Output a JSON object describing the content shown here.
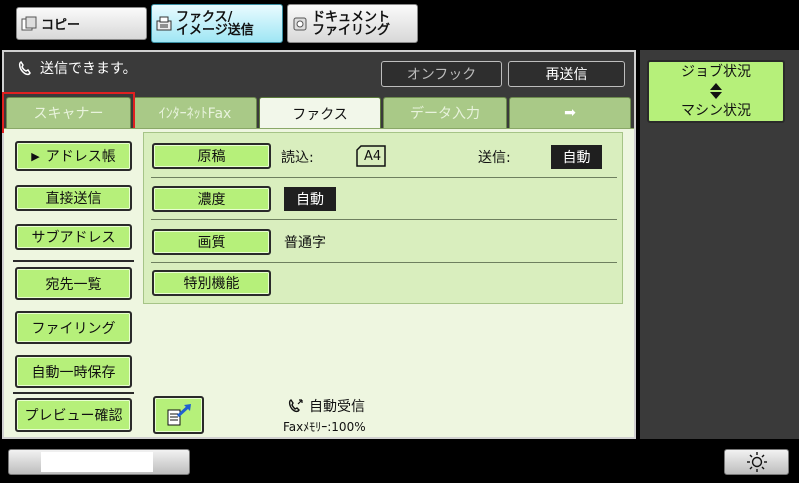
{
  "mode_tabs": [
    {
      "label": "コピー",
      "icon": "copy-icon"
    },
    {
      "label": "ファクス/\nイメージ送信",
      "icon": "fax-icon"
    },
    {
      "label": "ドキュメント\nファイリング",
      "icon": "document-icon"
    }
  ],
  "status": {
    "text": "送信できます。",
    "icon": "phone-icon"
  },
  "top_buttons": {
    "onhook": "オンフック",
    "resend": "再送信"
  },
  "tabs": [
    "スキャナー",
    "ｲﾝﾀｰﾈｯﾄFax",
    "ファクス",
    "データ入力",
    "➡"
  ],
  "side_buttons": {
    "address_book": "アドレス帳",
    "direct_send": "直接送信",
    "sub_address": "サブアドレス",
    "destination_list": "宛先一覧",
    "filing": "ファイリング",
    "auto_temp_save": "自動一時保存",
    "preview": "プレビュー確認"
  },
  "settings": {
    "original": {
      "button": "原稿",
      "read_label": "読込:",
      "read_value": "A4",
      "send_label": "送信:",
      "send_value": "自動"
    },
    "density": {
      "button": "濃度",
      "value": "自動"
    },
    "quality": {
      "button": "画質",
      "value": "普通字"
    },
    "special": {
      "button": "特別機能"
    }
  },
  "footer": {
    "auto_receive": "自動受信",
    "memory": "Faxﾒﾓﾘｰ:100%"
  },
  "right": {
    "job_status": "ジョブ状況",
    "machine_status": "マシン状況"
  }
}
